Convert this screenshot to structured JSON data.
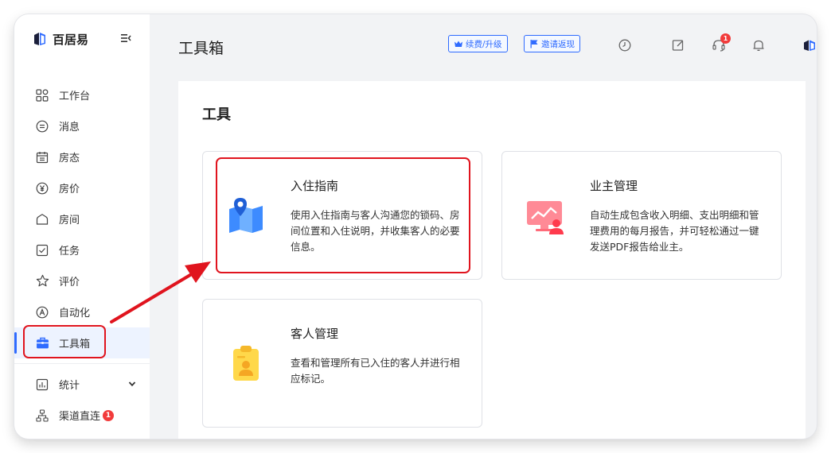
{
  "app": {
    "brand": "百居易"
  },
  "sidebar": {
    "items": [
      {
        "label": "工作台",
        "icon": "dashboard-icon"
      },
      {
        "label": "消息",
        "icon": "message-icon"
      },
      {
        "label": "房态",
        "icon": "calendar-icon"
      },
      {
        "label": "房价",
        "icon": "yen-icon"
      },
      {
        "label": "房间",
        "icon": "house-icon"
      },
      {
        "label": "任务",
        "icon": "task-check-icon"
      },
      {
        "label": "评价",
        "icon": "star-icon"
      },
      {
        "label": "自动化",
        "icon": "automation-a-icon"
      },
      {
        "label": "工具箱",
        "icon": "toolbox-icon",
        "active": true
      },
      {
        "label": "统计",
        "icon": "chart-icon",
        "expandable": true
      },
      {
        "label": "渠道直连",
        "icon": "channel-tree-icon",
        "badge": "1"
      }
    ]
  },
  "header": {
    "title": "工具箱",
    "renew_button": "续费/升级",
    "invite_button": "邀请返现",
    "support_badge": "1"
  },
  "main": {
    "section_title": "工具",
    "cards": [
      {
        "title": "入住指南",
        "description": "使用入住指南与客人沟通您的锁码、房间位置和入住说明，并收集客人的必要信息。",
        "icon": "map-pin-icon"
      },
      {
        "title": "业主管理",
        "description": "自动生成包含收入明细、支出明细和管理费用的每月报告，并可轻松通过一键发送PDF报告给业主。",
        "icon": "owner-report-icon"
      },
      {
        "title": "客人管理",
        "description": "查看和管理所有已入住的客人并进行相应标记。",
        "icon": "guest-badge-icon"
      }
    ]
  },
  "colors": {
    "accent": "#2f6bff",
    "highlight": "#e0141e",
    "badge": "#f23b3b"
  }
}
